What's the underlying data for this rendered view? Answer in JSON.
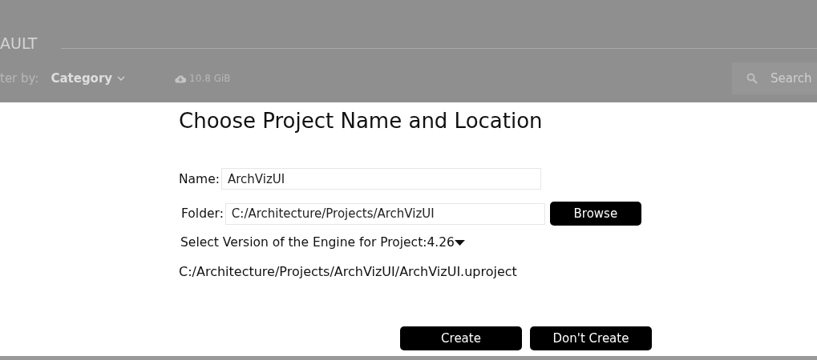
{
  "header": {
    "tab_label": "AULT",
    "filter_label": "ter by:",
    "filter_value": "Category",
    "storage": "10.8 GiB",
    "search": {
      "placeholder": "Search"
    }
  },
  "dialog": {
    "title": "Choose Project Name and Location",
    "name": {
      "label": "Name:",
      "value": "ArchVizUI"
    },
    "folder": {
      "label": "Folder:",
      "value": "C:/Architecture/Projects/ArchVizUI",
      "button": "Browse"
    },
    "version": {
      "label": "Select Version of the Engine for Project:",
      "value": "4.26"
    },
    "path": "C:/Architecture/Projects/ArchVizUI/ArchVizUI.uproject",
    "buttons": [
      "Create",
      "Don't Create"
    ]
  }
}
